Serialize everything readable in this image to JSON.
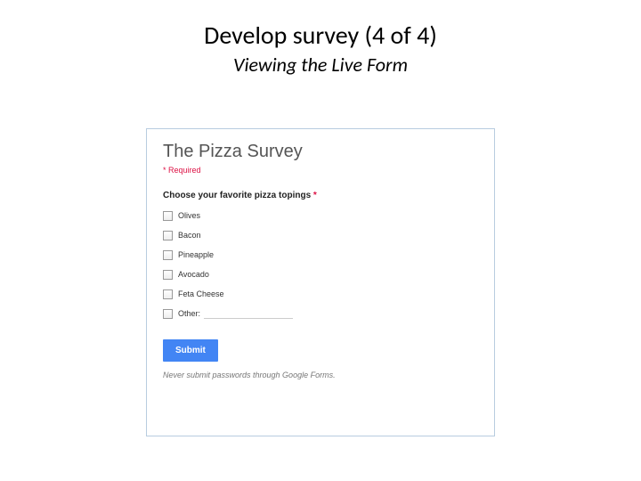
{
  "slide": {
    "title": "Develop survey (4 of 4)",
    "subtitle": "Viewing the Live Form"
  },
  "form": {
    "title": "The Pizza Survey",
    "required_note": "* Required",
    "question": {
      "label": "Choose your favorite pizza topings ",
      "required_mark": "*",
      "options": [
        "Olives",
        "Bacon",
        "Pineapple",
        "Avocado",
        "Feta Cheese"
      ],
      "other_label": "Other:"
    },
    "submit_label": "Submit",
    "footer": "Never submit passwords through Google Forms."
  }
}
